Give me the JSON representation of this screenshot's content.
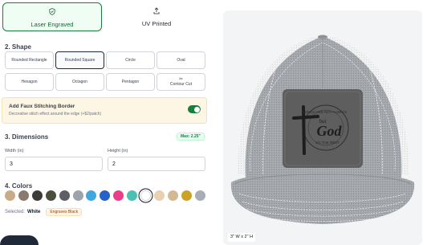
{
  "engraving_methods": [
    {
      "label": "Laser Engraved",
      "icon": "shield-check-icon",
      "selected": true
    },
    {
      "label": "UV Printed",
      "icon": "upload-icon",
      "selected": false
    }
  ],
  "shape": {
    "title": "2. Shape",
    "options": [
      {
        "label": "Rounded Rectangle",
        "selected": false
      },
      {
        "label": "Rounded Square",
        "selected": true
      },
      {
        "label": "Circle",
        "selected": false
      },
      {
        "label": "Oval",
        "selected": false
      },
      {
        "label": "Hexagon",
        "selected": false
      },
      {
        "label": "Octagon",
        "selected": false
      },
      {
        "label": "Pentagon",
        "selected": false
      },
      {
        "label": "Contour Cut",
        "icon": "scissors-icon",
        "selected": false
      }
    ]
  },
  "faux_stitching": {
    "title": "Add Faux Stitching Border",
    "subtitle": "Decorative stitch effect around the edge (+$2/patch)",
    "enabled": true
  },
  "dimensions": {
    "title": "3. Dimensions",
    "max_label": "Max: 2.25\"",
    "width_label": "Width (in)",
    "width_value": "3",
    "height_label": "Height (in)",
    "height_value": "2"
  },
  "colors": {
    "title": "4. Colors",
    "swatches": [
      "#c9ab89",
      "#8a7a6e",
      "#3d3b38",
      "#4a4f3b",
      "#5c5f63",
      "#9ca3ab",
      "#3fa7e0",
      "#2563c9",
      "#e83e8c",
      "#4bc0b5",
      "#ffffff",
      "#e8d0b0",
      "#d4b896",
      "#c9a227",
      "#a8aeb6"
    ],
    "selected_index": 10,
    "selected_label": "Selected:",
    "selected_value": "White",
    "engraves_badge": "Engraves Black"
  },
  "preview": {
    "patch_text": {
      "top_arc": "THINGS ARE NOT ALWAYS",
      "mid_small": "but",
      "mid_large": "God",
      "bottom_arc": "SO THE REST"
    },
    "size_label": "3\" W x 2\" H"
  },
  "colors_theme": {
    "accent": "#15803d",
    "cap_gray": "#9aa0a6",
    "patch": "#5a5a5a"
  }
}
